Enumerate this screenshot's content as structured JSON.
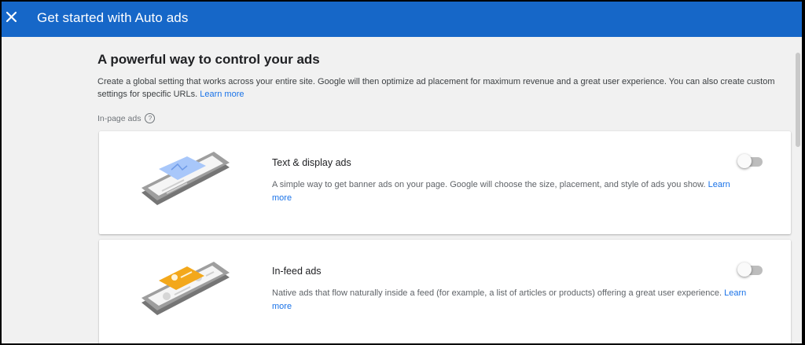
{
  "header": {
    "title": "Get started with Auto ads",
    "close_icon": "close-icon",
    "background": "#1667c8"
  },
  "main": {
    "headline": "A powerful way to control your ads",
    "description": "Create a global setting that works across your entire site. Google will then optimize ad placement for maximum revenue and a great user experience. You can also create custom settings for specific URLs.",
    "learn_more": "Learn more",
    "section_label": "In-page ads",
    "help_icon": "help-icon"
  },
  "cards": [
    {
      "title": "Text & display ads",
      "description": "A simple way to get banner ads on your page. Google will choose the size, placement, and style of ads you show.",
      "learn_more": "Learn more",
      "enabled": false,
      "illustration_color": "#a8c7fa"
    },
    {
      "title": "In-feed ads",
      "description": "Native ads that flow naturally inside a feed (for example, a list of articles or products) offering a great user experience.",
      "learn_more": "Learn more",
      "enabled": false,
      "illustration_color": "#f3a81b"
    }
  ],
  "colors": {
    "accent_link": "#1a73e8",
    "page_bg": "#f1f1f1"
  }
}
